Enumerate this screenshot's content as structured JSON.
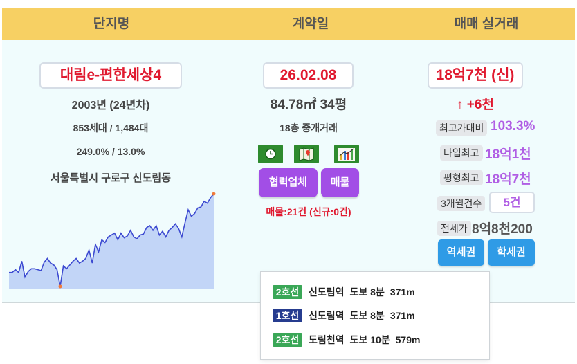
{
  "header": {
    "col1": "단지명",
    "col2": "계약일",
    "col3": "매매 실거래"
  },
  "complex": {
    "name": "대림e-편한세상4",
    "year": "2003년 (24년차)",
    "units": "853세대 / 1,484대",
    "ratio": "249.0% / 13.0%",
    "address": "서울특별시 구로구 신도림동"
  },
  "contract": {
    "date": "26.02.08",
    "area": "84.78㎡ 34평",
    "floor_type": "18층 중개거래",
    "icons": [
      "clock-icon",
      "map-icon",
      "bar-chart-icon"
    ],
    "partner_button": "협력업체",
    "listing_button": "매물",
    "listing_count": "매물:21건 (신규:0건)"
  },
  "trade": {
    "price": "18억7천 (신)",
    "change": "↑ +6천",
    "max_ratio_label": "최고가대비",
    "max_ratio_value": "103.3%",
    "type_max_label": "타입최고",
    "type_max_value": "18억1천",
    "area_max_label": "평형최고",
    "area_max_value": "18억7천",
    "three_month_label": "3개월건수",
    "three_month_value": "5건",
    "jeonse_label": "전세가",
    "jeonse_value": "8억8천200",
    "station_button": "역세권",
    "school_button": "학세권"
  },
  "stations": [
    {
      "line": "2호선",
      "line_color": "#3aa757",
      "station": "신도림역",
      "walk": "도보 8분",
      "dist": "371m"
    },
    {
      "line": "1호선",
      "line_color": "#263c8f",
      "station": "신도림역",
      "walk": "도보 8분",
      "dist": "371m"
    },
    {
      "line": "2호선",
      "line_color": "#3aa757",
      "station": "도림천역",
      "walk": "도보 10분",
      "dist": "579m"
    }
  ],
  "colors": {
    "header": "#f7d063",
    "panel": "#f0fcfd",
    "red": "#e0192f",
    "purple": "#a24ee6",
    "blue": "#2f9be6",
    "sparkline": "#3d4ad1",
    "sparkline_fill": "#c2d5f7"
  },
  "sparkline": [
    0.1,
    0.1,
    0.13,
    0.1,
    0.22,
    0.05,
    0.11,
    0.14,
    0.14,
    0.13,
    0.12,
    0.21,
    0.25,
    0.2,
    0.18,
    0.13,
    -0.05,
    0.17,
    0.14,
    0.18,
    0.22,
    0.25,
    0.2,
    0.22,
    0.25,
    0.34,
    0.2,
    0.4,
    0.32,
    0.45,
    0.42,
    0.48,
    0.5,
    0.52,
    0.45,
    0.52,
    0.47,
    0.49,
    0.55,
    0.48,
    0.46,
    0.5,
    0.51,
    0.58,
    0.6,
    0.55,
    0.6,
    0.5,
    0.54,
    0.48,
    0.55,
    0.58,
    0.62,
    0.57,
    0.48,
    0.63,
    0.77,
    0.7,
    0.73,
    0.79,
    0.8,
    0.86,
    0.84,
    0.9,
    0.94
  ]
}
